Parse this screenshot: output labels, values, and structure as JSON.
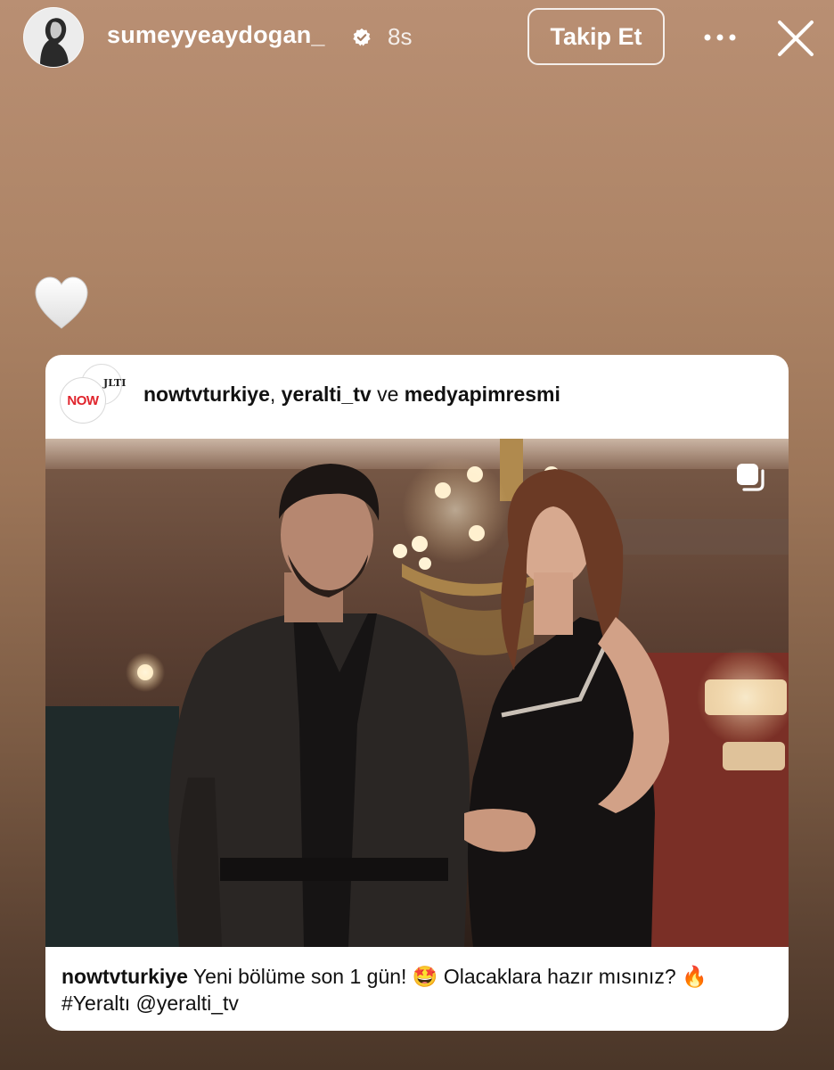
{
  "header": {
    "username": "sumeyyeaydogan_",
    "verified": true,
    "time_ago": "8s",
    "follow_label": "Takip Et",
    "more_icon": "more-horizontal-icon",
    "close_icon": "close-icon"
  },
  "reaction": {
    "icon": "white-heart-icon"
  },
  "post": {
    "logo_text": "NOW",
    "collab": {
      "user1": "nowtvturkiye",
      "separator": ",",
      "user2": "yeralti_tv",
      "joiner": "ve",
      "user3": "medyapimresmi"
    },
    "carousel_icon": "multiple-posts-icon",
    "caption": {
      "username": "nowtvturkiye",
      "text_part1": "Yeni bölüme son 1 gün!",
      "emoji1": "🤩",
      "text_part2": "Olacaklara hazır mısınız?",
      "emoji2": "🔥",
      "hashtag": "#Yeraltı",
      "mention": "@yeralti_tv"
    }
  },
  "colors": {
    "brand_red": "#e0242c",
    "text_dark": "#111111",
    "overlay_white": "#ffffff"
  }
}
